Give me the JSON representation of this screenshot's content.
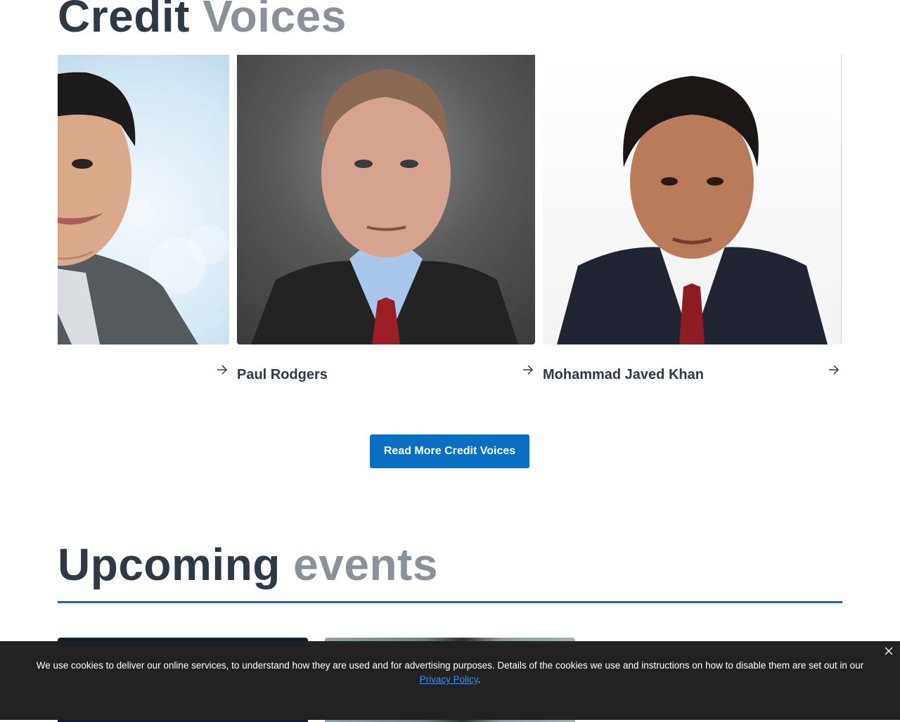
{
  "credit_voices": {
    "title_strong": "Credit",
    "title_light": "Voices",
    "cards": [
      {
        "name": "",
        "photo": "portrait-man-smiling-grey-suit"
      },
      {
        "name": "Paul Rodgers",
        "photo": "portrait-man-red-tie"
      },
      {
        "name": "Mohammad Javed Khan",
        "photo": "portrait-man-dark-suit"
      }
    ],
    "arrow_icon": "arrow-right-icon",
    "cta_label": "Read More Credit Voices"
  },
  "events": {
    "title_strong": "Upcoming",
    "title_light": "events"
  },
  "cookie_banner": {
    "text": "We use cookies to deliver our online services, to understand how they are used and for advertising purposes. Details of the cookies we use and instructions on how to disable them are set out in our",
    "link_text": "Privacy Policy",
    "end_text": ".",
    "close_icon": "close-icon"
  },
  "colors": {
    "accent_blue": "#0a6fc2",
    "title_dark": "#2d3a46",
    "title_light": "#8a9198",
    "cookie_bg": "#222222"
  }
}
